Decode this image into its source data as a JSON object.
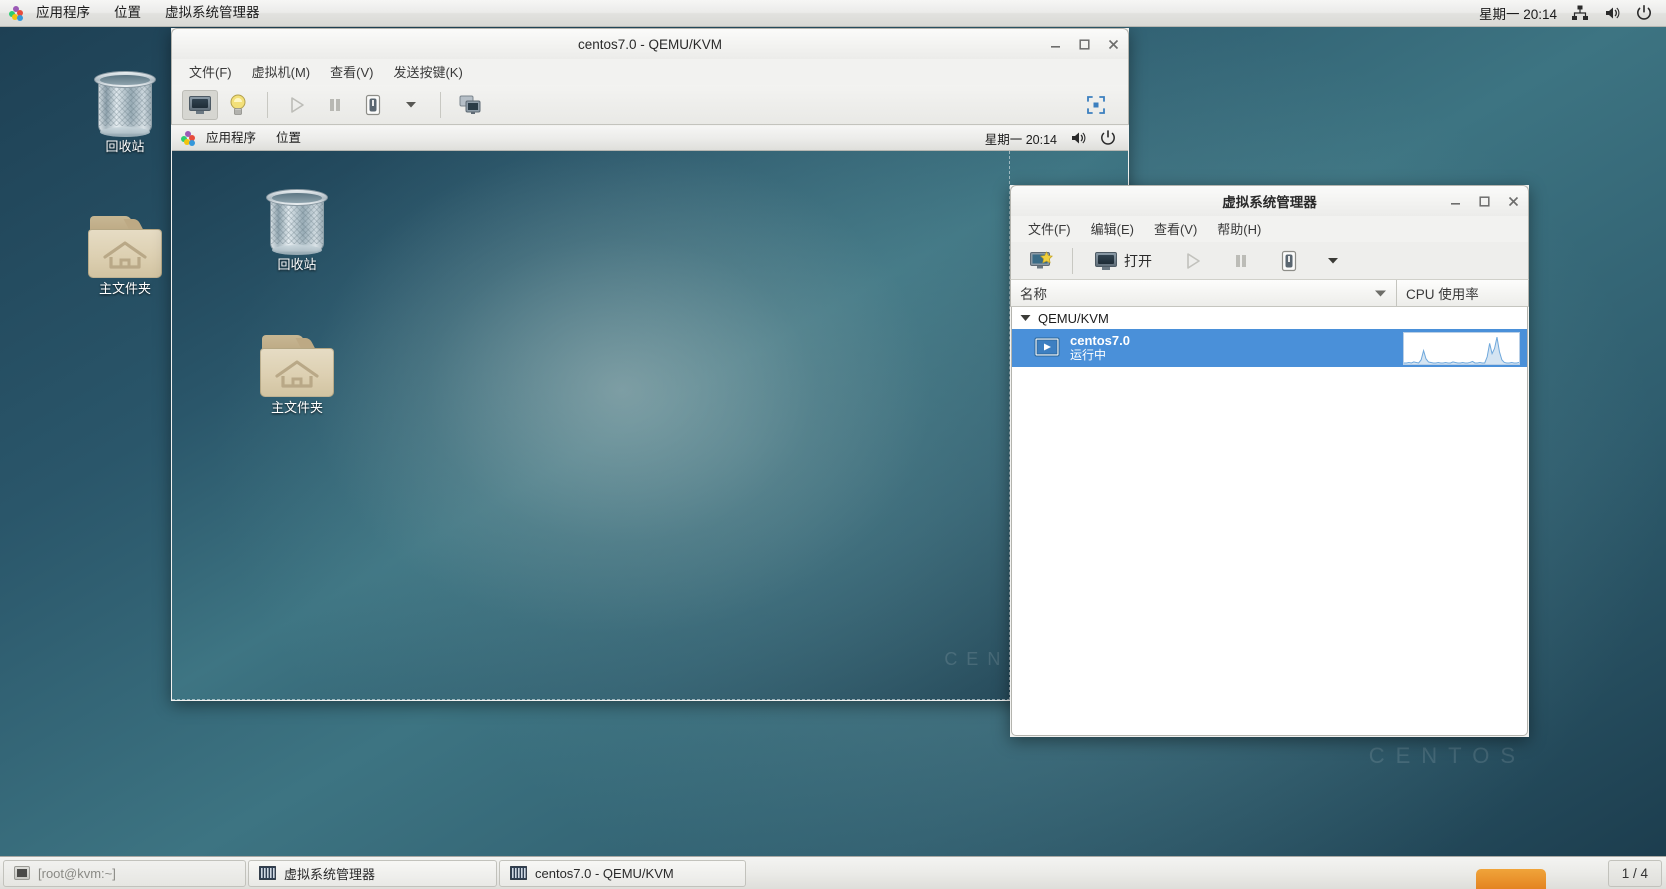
{
  "top_panel": {
    "logo_icon": "gnome-foot-icon",
    "items": [
      {
        "label": "应用程序",
        "name": "applications-menu"
      },
      {
        "label": "位置",
        "name": "places-menu"
      },
      {
        "label": "虚拟系统管理器",
        "name": "virt-manager-menu"
      }
    ],
    "clock": "星期一  20:14",
    "tray": [
      {
        "name": "network-icon"
      },
      {
        "name": "volume-icon"
      },
      {
        "name": "power-icon"
      }
    ]
  },
  "desktop": {
    "watermark": "CENTOS",
    "icons": [
      {
        "label": "回收站",
        "name": "desktop-icon-trash",
        "art": "trash"
      },
      {
        "label": "主文件夹",
        "name": "desktop-icon-home-folder",
        "art": "folder"
      }
    ]
  },
  "vm_window": {
    "title": "centos7.0 - QEMU/KVM",
    "window_buttons": [
      {
        "name": "minimize-button",
        "glyph": "–"
      },
      {
        "name": "maximize-button",
        "glyph": "□"
      },
      {
        "name": "close-button",
        "glyph": "✕"
      }
    ],
    "menus": [
      {
        "label": "文件(F)",
        "name": "vm-menu-file"
      },
      {
        "label": "虚拟机(M)",
        "name": "vm-menu-machine"
      },
      {
        "label": "查看(V)",
        "name": "vm-menu-view"
      },
      {
        "label": "发送按键(K)",
        "name": "vm-menu-sendkey"
      }
    ],
    "toolbar": [
      {
        "name": "console-view-button",
        "icon": "monitor-icon",
        "active": true
      },
      {
        "name": "details-view-button",
        "icon": "lightbulb-icon",
        "active": false
      },
      {
        "name": "run-button",
        "icon": "play-icon",
        "enabled": false
      },
      {
        "name": "pause-button",
        "icon": "pause-icon",
        "enabled": false
      },
      {
        "name": "shutdown-button",
        "icon": "shutdown-icon",
        "enabled": true
      },
      {
        "name": "shutdown-dropdown-button",
        "icon": "chevron-down-icon",
        "enabled": true
      },
      {
        "name": "snapshots-button",
        "icon": "screens-icon",
        "enabled": true
      }
    ],
    "fullscreen_icon": "fullscreen-icon",
    "guest": {
      "panel_items": [
        {
          "label": "应用程序",
          "name": "guest-applications-menu"
        },
        {
          "label": "位置",
          "name": "guest-places-menu"
        }
      ],
      "clock": "星期一  20:14",
      "tray": [
        {
          "name": "guest-volume-icon"
        },
        {
          "name": "guest-power-icon"
        }
      ],
      "watermark": "CENTOS",
      "icons": [
        {
          "label": "回收站",
          "name": "guest-desktop-icon-trash",
          "art": "trash"
        },
        {
          "label": "主文件夹",
          "name": "guest-desktop-icon-home-folder",
          "art": "folder"
        }
      ]
    }
  },
  "vmm_window": {
    "title": "虚拟系统管理器",
    "window_buttons": [
      {
        "name": "minimize-button",
        "glyph": "–"
      },
      {
        "name": "maximize-button",
        "glyph": "□"
      },
      {
        "name": "close-button",
        "glyph": "✕"
      }
    ],
    "menus": [
      {
        "label": "文件(F)",
        "name": "vmm-menu-file"
      },
      {
        "label": "编辑(E)",
        "name": "vmm-menu-edit"
      },
      {
        "label": "查看(V)",
        "name": "vmm-menu-view"
      },
      {
        "label": "帮助(H)",
        "name": "vmm-menu-help"
      }
    ],
    "toolbar": {
      "new_vm": {
        "name": "new-vm-button",
        "icon": "new-vm-icon"
      },
      "open_label": "打开",
      "open_name": "open-vm-button",
      "run": {
        "name": "run-button",
        "icon": "play-icon",
        "enabled": false
      },
      "pause": {
        "name": "pause-button",
        "icon": "pause-icon",
        "enabled": false
      },
      "shutdown": {
        "name": "shutdown-button",
        "icon": "shutdown-icon",
        "enabled": true
      },
      "dropdown": {
        "name": "shutdown-dropdown-button",
        "icon": "chevron-down-icon"
      }
    },
    "columns": [
      {
        "label": "名称",
        "name": "column-header-name"
      },
      {
        "label": "CPU 使用率",
        "name": "column-header-cpu-usage"
      }
    ],
    "sort_icon": "sort-descending-icon",
    "connection": {
      "label": "QEMU/KVM",
      "expanded": true,
      "expander_icon": "triangle-down-icon"
    },
    "vms": [
      {
        "name": "centos7.0",
        "state": "运行中",
        "selected": true,
        "icon": "vm-running-icon",
        "cpu_sparkline": [
          2,
          2,
          3,
          2,
          4,
          3,
          2,
          8,
          26,
          10,
          4,
          3,
          2,
          2,
          3,
          2,
          2,
          3,
          2,
          2,
          4,
          3,
          2,
          2,
          3,
          2,
          2,
          3,
          5,
          2,
          2,
          3,
          2,
          2,
          14,
          40,
          20,
          30,
          52,
          24,
          8,
          3,
          2,
          2,
          3,
          2,
          2,
          3
        ]
      }
    ],
    "accent_color": "#4a90d9"
  },
  "taskbar": {
    "items": [
      {
        "label": "[root@kvm:~]",
        "name": "taskbar-item-terminal",
        "icon": "terminal-icon",
        "minimized": true
      },
      {
        "label": "虚拟系统管理器",
        "name": "taskbar-item-virt-manager",
        "icon": "virt-manager-icon",
        "minimized": false
      },
      {
        "label": "centos7.0 - QEMU/KVM",
        "name": "taskbar-item-vm-console",
        "icon": "virt-manager-icon",
        "minimized": false
      }
    ],
    "workspace": "1 / 4"
  }
}
